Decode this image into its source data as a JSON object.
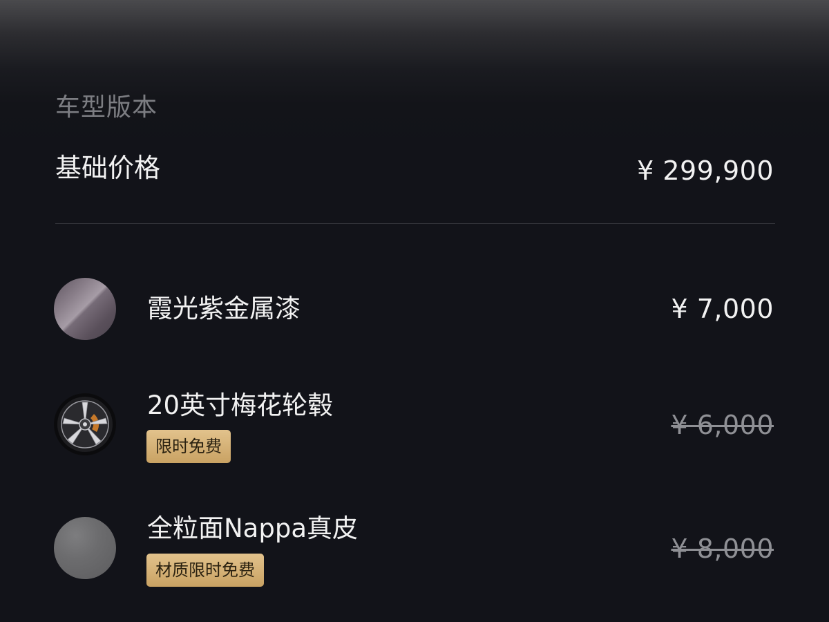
{
  "section": {
    "label": "车型版本"
  },
  "base": {
    "title": "基础价格",
    "price": "¥ 299,900"
  },
  "options": [
    {
      "name": "霞光紫金属漆",
      "price": "¥ 7,000",
      "struck": false,
      "badge": "",
      "icon": "paint-swatch-icon"
    },
    {
      "name": "20英寸梅花轮毂",
      "price": "¥ 6,000",
      "struck": true,
      "badge": "限时免费",
      "icon": "wheel-icon"
    },
    {
      "name": "全粒面Nappa真皮",
      "price": "¥ 8,000",
      "struck": true,
      "badge": "材质限时免费",
      "icon": "leather-swatch-icon"
    }
  ],
  "colors": {
    "background": "#121319",
    "badge_gold": "#d6b377",
    "muted_text": "#7c7d82",
    "paint_swatch": "#8a7f8a",
    "leather_swatch": "#6c6c6e"
  }
}
